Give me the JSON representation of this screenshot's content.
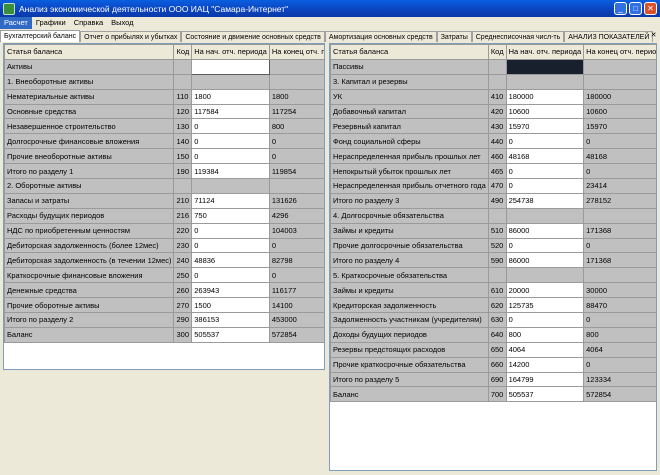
{
  "window": {
    "title": "Анализ экономической деятельности ООО ИАЦ \"Самара-Интернет\""
  },
  "menu": [
    {
      "label": "Расчет",
      "active": true
    },
    {
      "label": "Графики",
      "active": false
    },
    {
      "label": "Справка",
      "active": false
    },
    {
      "label": "Выход",
      "active": false
    }
  ],
  "tabs": [
    {
      "label": "Бухгалтерский баланс",
      "active": true
    },
    {
      "label": "Отчет о прибылях и убытках",
      "active": false
    },
    {
      "label": "Состояние и движение основных средств",
      "active": false
    },
    {
      "label": "Амортизация основных средств",
      "active": false
    },
    {
      "label": "Затраты",
      "active": false
    },
    {
      "label": "Среднесписочная числ-ть",
      "active": false
    },
    {
      "label": "АНАЛИЗ ПОКАЗАТЕЛЕЙ",
      "active": false
    }
  ],
  "columns": [
    "Статья баланса",
    "Код",
    "На нач. отч. периода",
    "На конец отч. периода"
  ],
  "assets": [
    {
      "name": "Активы",
      "code": "",
      "start": "",
      "end": ""
    },
    {
      "name": "1. Внеоборотные активы",
      "code": "",
      "start": "",
      "end": ""
    },
    {
      "name": "Нематериальные активы",
      "code": "110",
      "start": "1800",
      "end": "1800"
    },
    {
      "name": "Основные средства",
      "code": "120",
      "start": "117584",
      "end": "117254"
    },
    {
      "name": "Незавершенное строительство",
      "code": "130",
      "start": "0",
      "end": "800"
    },
    {
      "name": "Долгосрочные финансовые вложения",
      "code": "140",
      "start": "0",
      "end": "0"
    },
    {
      "name": "Прочие внеоборотные активы",
      "code": "150",
      "start": "0",
      "end": "0"
    },
    {
      "name": "Итого по разделу 1",
      "code": "190",
      "start": "119384",
      "end": "119854"
    },
    {
      "name": "2. Оборотные активы",
      "code": "",
      "start": "",
      "end": ""
    },
    {
      "name": "Запасы  и затраты",
      "code": "210",
      "start": "71124",
      "end": "131626"
    },
    {
      "name": "Расходы будущих периодов",
      "code": "216",
      "start": "750",
      "end": "4296"
    },
    {
      "name": "НДС по приобретенным ценностям",
      "code": "220",
      "start": "0",
      "end": "104003"
    },
    {
      "name": "Дебиторская задолженность (более 12мес)",
      "code": "230",
      "start": "0",
      "end": "0"
    },
    {
      "name": "Дебиторская задолженность (в течении 12мес)",
      "code": "240",
      "start": "48836",
      "end": "82798"
    },
    {
      "name": "Краткосрочные финансовые вложения",
      "code": "250",
      "start": "0",
      "end": "0"
    },
    {
      "name": "Денежные средства",
      "code": "260",
      "start": "263943",
      "end": "116177"
    },
    {
      "name": "Прочие оборотные активы",
      "code": "270",
      "start": "1500",
      "end": "14100"
    },
    {
      "name": "Итого по разделу 2",
      "code": "290",
      "start": "386153",
      "end": "453000"
    },
    {
      "name": "Баланс",
      "code": "300",
      "start": "505537",
      "end": "572854"
    }
  ],
  "liabilities": [
    {
      "name": "Пассивы",
      "code": "",
      "start": "",
      "end": ""
    },
    {
      "name": "3. Капитал и резервы",
      "code": "",
      "start": "",
      "end": ""
    },
    {
      "name": "УК",
      "code": "410",
      "start": "180000",
      "end": "180000"
    },
    {
      "name": "Добавочный капитал",
      "code": "420",
      "start": "10600",
      "end": "10600"
    },
    {
      "name": "Резервный капитал",
      "code": "430",
      "start": "15970",
      "end": "15970"
    },
    {
      "name": "Фонд социальной сферы",
      "code": "440",
      "start": "0",
      "end": "0"
    },
    {
      "name": "Нераспределенная прибыль прошлых лет",
      "code": "460",
      "start": "48168",
      "end": "48168"
    },
    {
      "name": "Непокрытый убыток прошлых лет",
      "code": "465",
      "start": "0",
      "end": "0"
    },
    {
      "name": "Нераспределенная прибыль отчетного года",
      "code": "470",
      "start": "0",
      "end": "23414"
    },
    {
      "name": "Итого по разделу 3",
      "code": "490",
      "start": "254738",
      "end": "278152"
    },
    {
      "name": "4. Долгосрочные обязательства",
      "code": "",
      "start": "",
      "end": ""
    },
    {
      "name": "Займы и кредиты",
      "code": "510",
      "start": "86000",
      "end": "171368"
    },
    {
      "name": "Прочие долгосрочные обязательства",
      "code": "520",
      "start": "0",
      "end": "0"
    },
    {
      "name": "Итого по разделу 4",
      "code": "590",
      "start": "86000",
      "end": "171368"
    },
    {
      "name": "5. Краткосрочные обязательства",
      "code": "",
      "start": "",
      "end": ""
    },
    {
      "name": "Займы и кредиты",
      "code": "610",
      "start": "20000",
      "end": "30000"
    },
    {
      "name": "Кредиторская задолженность",
      "code": "620",
      "start": "125735",
      "end": "88470"
    },
    {
      "name": "Задолженность участникам (учредителям)",
      "code": "630",
      "start": "0",
      "end": "0"
    },
    {
      "name": "Доходы будущих периодов",
      "code": "640",
      "start": "800",
      "end": "800"
    },
    {
      "name": "Резервы предстоящих расходов",
      "code": "650",
      "start": "4064",
      "end": "4064"
    },
    {
      "name": "Прочие краткосрочные обязательства",
      "code": "660",
      "start": "14200",
      "end": "0"
    },
    {
      "name": "Итого по разделу 5",
      "code": "690",
      "start": "164799",
      "end": "123334"
    },
    {
      "name": "Баланс",
      "code": "700",
      "start": "505537",
      "end": "572854"
    }
  ]
}
